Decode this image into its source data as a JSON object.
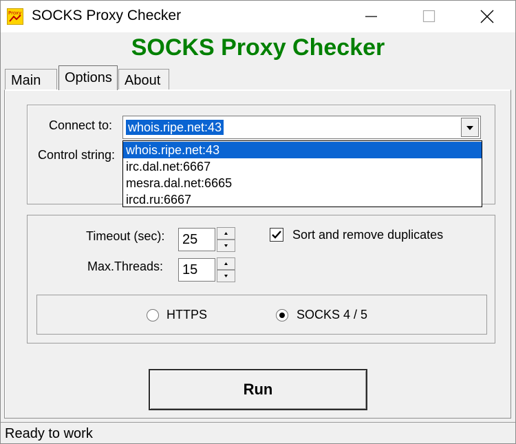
{
  "window": {
    "title": "SOCKS Proxy Checker"
  },
  "app_icon": {
    "name": "proxy-app-icon",
    "text": "Proxy"
  },
  "heading": {
    "text": "SOCKS Proxy Checker",
    "color": "#008000"
  },
  "tabs": [
    {
      "label": "Main",
      "active": false
    },
    {
      "label": "Options",
      "active": true
    },
    {
      "label": "About",
      "active": false
    }
  ],
  "connection": {
    "connect_to_label": "Connect to:",
    "connect_to_value": "whois.ripe.net:43",
    "control_string_label": "Control string:",
    "dropdown_options": [
      "whois.ripe.net:43",
      "irc.dal.net:6667",
      "mesra.dal.net:6665",
      "ircd.ru:6667"
    ],
    "selected_index": 0
  },
  "settings": {
    "timeout_label": "Timeout (sec):",
    "timeout_value": "25",
    "max_threads_label": "Max.Threads:",
    "max_threads_value": "15",
    "sort_label": "Sort and remove duplicates",
    "sort_checked": true
  },
  "proxy_type": {
    "https_label": "HTTPS",
    "socks_label": "SOCKS 4 / 5",
    "selected": "SOCKS 4 / 5"
  },
  "run_button": {
    "label": "Run"
  },
  "status": {
    "text": "Ready to work"
  },
  "colors": {
    "selection": "#0a64d2",
    "window_bg": "#f0f0f0"
  }
}
